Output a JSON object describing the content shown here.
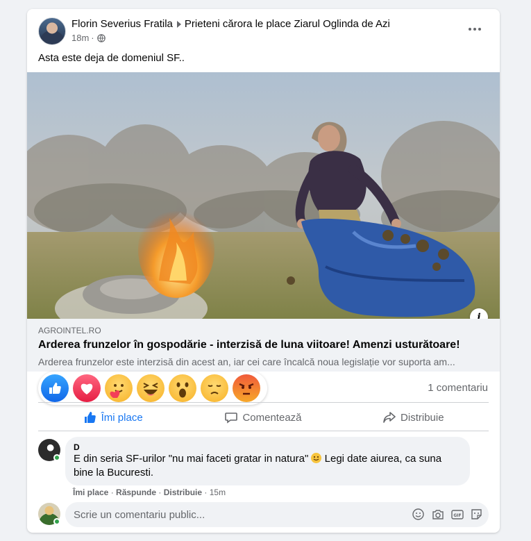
{
  "post": {
    "author": "Florin Severius Fratila",
    "group": "Prieteni cărora le place Ziarul Oglinda de Azi",
    "time": "18m",
    "text": "Asta este deja de domeniul SF.."
  },
  "link": {
    "domain": "AGROINTEL.RO",
    "title": "Arderea frunzelor în gospodărie - interzisă de luna viitoare! Amenzi usturătoare!",
    "description": "Arderea frunzelor este interzisă din acest an, iar cei care încalcă noua legislație vor suporta am..."
  },
  "reactions": [
    "like-icon",
    "love-icon",
    "care-icon",
    "haha-icon",
    "wow-icon",
    "sad-icon",
    "angry-icon"
  ],
  "stats": {
    "comments": "1 comentariu"
  },
  "actions": {
    "like": "Îmi place",
    "comment": "Comentează",
    "share": "Distribuie"
  },
  "comment": {
    "author": "D",
    "text": "E din seria SF-urilor \"nu mai faceti gratar in natura\"",
    "text_tail": " Legi date aiurea, ca suna bine la Bucuresti.",
    "like": "Îmi place",
    "reply": "Răspunde",
    "share": "Distribuie",
    "time": "15m"
  },
  "composer": {
    "placeholder": "Scrie un comentariu public..."
  },
  "colors": {
    "accent": "#1877f2",
    "secondary_text": "#65676b",
    "surface": "#f0f2f5"
  }
}
